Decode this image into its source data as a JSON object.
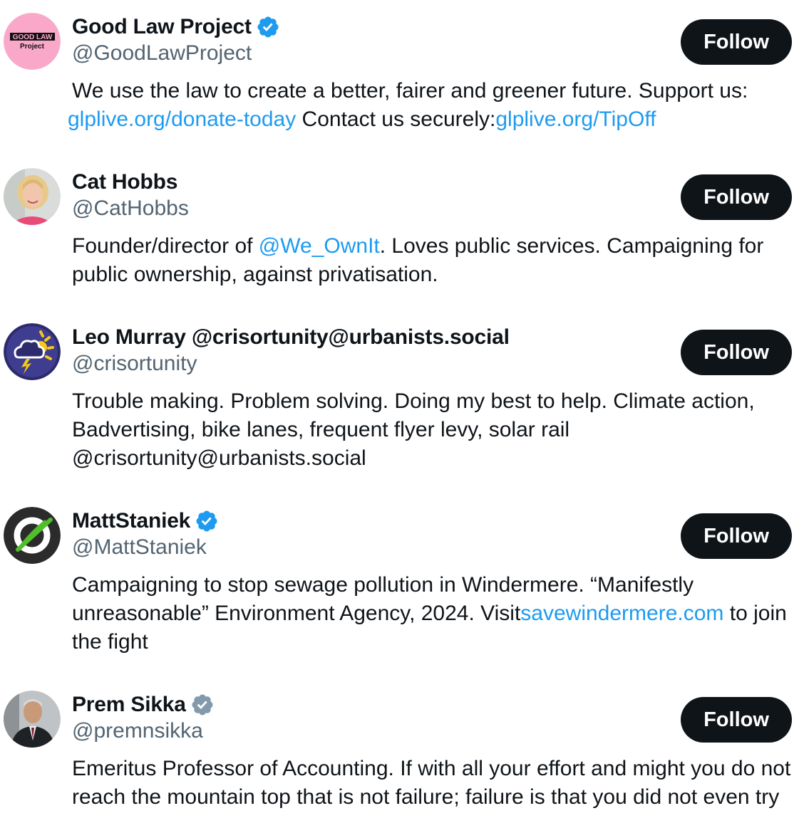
{
  "accounts": [
    {
      "name": "Good Law Project",
      "verified": "blue",
      "handle": "@GoodLawProject",
      "follow_label": "Follow",
      "avatar": {
        "logo_text_top": "GOOD LAW",
        "logo_text_bottom": "Project",
        "bg": "#f9a8c9"
      },
      "bio": {
        "line1": "We use the law to create a better, fairer and greener future. Support us:",
        "link1": "glplive.org/donate-today",
        "text2": " Contact us securely:",
        "link2": "glplive.org/TipOff"
      }
    },
    {
      "name": "Cat Hobbs",
      "handle": "@CatHobbs",
      "follow_label": "Follow",
      "bio": {
        "text1": "Founder/director of ",
        "mention": "@We_OwnIt",
        "text2": ". Loves public services. Campaigning for public ownership, against privatisation."
      }
    },
    {
      "name": "Leo Murray @crisortunity@urbanists.social",
      "handle": "@crisortunity",
      "follow_label": "Follow",
      "bio": {
        "text": "Trouble making. Problem solving. Doing my best to help. Climate action, Badvertising, bike lanes, frequent flyer levy, solar rail @crisortunity@urbanists.social"
      }
    },
    {
      "name": "MattStaniek",
      "verified": "blue",
      "handle": "@MattStaniek",
      "follow_label": "Follow",
      "bio": {
        "text1": "Campaigning to stop sewage pollution in Windermere. “Manifestly unreasonable” Environment Agency, 2024. Visit",
        "link": "savewindermere.com",
        "text2": " to join the fight"
      }
    },
    {
      "name": "Prem Sikka",
      "verified": "grey",
      "handle": "@premnsikka",
      "follow_label": "Follow",
      "bio": {
        "text": "Emeritus Professor of Accounting. If with all your effort and might you do not reach the mountain top that is not failure; failure is that you did not even try"
      }
    }
  ],
  "colors": {
    "link": "#1d9bf0",
    "verified_blue": "#1d9bf0",
    "verified_grey": "#829aab",
    "button_bg": "#0f1419",
    "secondary_text": "#536471"
  }
}
